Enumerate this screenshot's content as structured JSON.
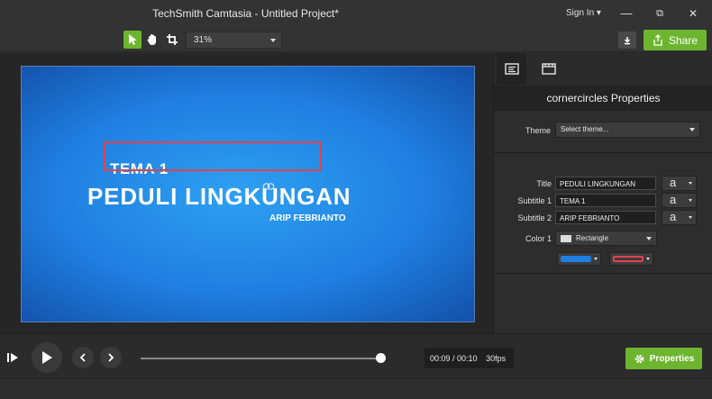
{
  "window": {
    "title": "TechSmith Camtasia - Untitled Project*",
    "signin_label": "Sign In ▾",
    "minimize_glyph": "—",
    "maximize_glyph": "⧉",
    "close_glyph": "✕"
  },
  "toolbar": {
    "zoom_value": "31%",
    "share_label": "Share",
    "active_tool": "select-arrow",
    "accent_color": "#6eb52f"
  },
  "canvas": {
    "slide_subtitle_1": "TEMA 1",
    "slide_title": "PEDULI LINGKUNGAN",
    "slide_subtitle_2": "ARIP FEBRIANTO",
    "selection_color": "#e0434b"
  },
  "properties": {
    "header": "cornercircles Properties",
    "theme_label": "Theme",
    "theme_value": "Select theme...",
    "title_label": "Title",
    "title_value": "PEDULI LINGKUNGAN",
    "subtitle1_label": "Subtitle 1",
    "subtitle1_value": "TEMA 1",
    "subtitle2_label": "Subtitle 2",
    "subtitle2_value": "ARIP FEBRIANTO",
    "font_glyph": "a",
    "color1_label": "Color 1",
    "color1_value": "Rectangle",
    "swatch_fill": "#1f7fe0",
    "swatch_outline": "#e0434b"
  },
  "playback": {
    "time_display": "00:09 / 00:10",
    "fps": "30fps",
    "progress_fraction": 0.9,
    "properties_button_label": "Properties"
  }
}
